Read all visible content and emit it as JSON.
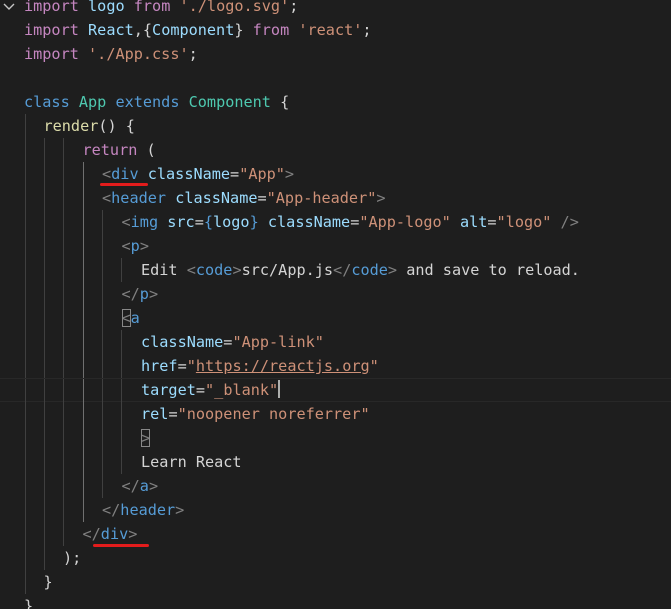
{
  "editor": {
    "language": "javascript-react",
    "lines": [
      {
        "indent": 0,
        "tokens": [
          {
            "t": "import",
            "c": "kw"
          },
          {
            "t": " ",
            "c": "pu"
          },
          {
            "t": "logo",
            "c": "vr"
          },
          {
            "t": " ",
            "c": "pu"
          },
          {
            "t": "from",
            "c": "kw"
          },
          {
            "t": " ",
            "c": "pu"
          },
          {
            "t": "'./logo.svg'",
            "c": "str"
          },
          {
            "t": ";",
            "c": "pu"
          }
        ]
      },
      {
        "indent": 0,
        "tokens": [
          {
            "t": "import",
            "c": "kw"
          },
          {
            "t": " ",
            "c": "pu"
          },
          {
            "t": "React",
            "c": "vr"
          },
          {
            "t": ",{",
            "c": "pu"
          },
          {
            "t": "Component",
            "c": "vr"
          },
          {
            "t": "} ",
            "c": "pu"
          },
          {
            "t": "from",
            "c": "kw"
          },
          {
            "t": " ",
            "c": "pu"
          },
          {
            "t": "'react'",
            "c": "str"
          },
          {
            "t": ";",
            "c": "pu"
          }
        ]
      },
      {
        "indent": 0,
        "tokens": [
          {
            "t": "import",
            "c": "kw"
          },
          {
            "t": " ",
            "c": "pu"
          },
          {
            "t": "'./App.css'",
            "c": "str"
          },
          {
            "t": ";",
            "c": "pu"
          }
        ]
      },
      {
        "indent": 0,
        "tokens": []
      },
      {
        "indent": 0,
        "tokens": [
          {
            "t": "class",
            "c": "st"
          },
          {
            "t": " ",
            "c": "pu"
          },
          {
            "t": "App",
            "c": "ty"
          },
          {
            "t": " ",
            "c": "pu"
          },
          {
            "t": "extends",
            "c": "st"
          },
          {
            "t": " ",
            "c": "pu"
          },
          {
            "t": "Component",
            "c": "ty"
          },
          {
            "t": " {",
            "c": "pu"
          }
        ]
      },
      {
        "indent": 1,
        "tokens": [
          {
            "t": "render",
            "c": "fn"
          },
          {
            "t": "() {",
            "c": "pu"
          }
        ]
      },
      {
        "indent": 3,
        "tokens": [
          {
            "t": "return",
            "c": "kw"
          },
          {
            "t": " (",
            "c": "pu"
          }
        ]
      },
      {
        "indent": 4,
        "tokens": [
          {
            "t": "<",
            "c": "br"
          },
          {
            "t": "div",
            "c": "tag"
          },
          {
            "t": " ",
            "c": "pu"
          },
          {
            "t": "className",
            "c": "vr"
          },
          {
            "t": "=",
            "c": "pu"
          },
          {
            "t": "\"App\"",
            "c": "str"
          },
          {
            "t": ">",
            "c": "br"
          }
        ]
      },
      {
        "indent": 4,
        "tokens": [
          {
            "t": "<",
            "c": "br"
          },
          {
            "t": "header",
            "c": "tag"
          },
          {
            "t": " ",
            "c": "pu"
          },
          {
            "t": "className",
            "c": "vr"
          },
          {
            "t": "=",
            "c": "pu"
          },
          {
            "t": "\"App-header\"",
            "c": "str"
          },
          {
            "t": ">",
            "c": "br"
          }
        ]
      },
      {
        "indent": 5,
        "tokens": [
          {
            "t": "<",
            "c": "br"
          },
          {
            "t": "img",
            "c": "tag"
          },
          {
            "t": " ",
            "c": "pu"
          },
          {
            "t": "src",
            "c": "vr"
          },
          {
            "t": "=",
            "c": "pu"
          },
          {
            "t": "{",
            "c": "jx"
          },
          {
            "t": "logo",
            "c": "vr"
          },
          {
            "t": "}",
            "c": "jx"
          },
          {
            "t": " ",
            "c": "pu"
          },
          {
            "t": "className",
            "c": "vr"
          },
          {
            "t": "=",
            "c": "pu"
          },
          {
            "t": "\"App-logo\"",
            "c": "str"
          },
          {
            "t": " ",
            "c": "pu"
          },
          {
            "t": "alt",
            "c": "vr"
          },
          {
            "t": "=",
            "c": "pu"
          },
          {
            "t": "\"logo\"",
            "c": "str"
          },
          {
            "t": " />",
            "c": "br"
          }
        ]
      },
      {
        "indent": 5,
        "tokens": [
          {
            "t": "<",
            "c": "br"
          },
          {
            "t": "p",
            "c": "tag"
          },
          {
            "t": ">",
            "c": "br"
          }
        ]
      },
      {
        "indent": 6,
        "tokens": [
          {
            "t": "Edit ",
            "c": "txt"
          },
          {
            "t": "<",
            "c": "br"
          },
          {
            "t": "code",
            "c": "tag"
          },
          {
            "t": ">",
            "c": "br"
          },
          {
            "t": "src/App.js",
            "c": "txt"
          },
          {
            "t": "</",
            "c": "br"
          },
          {
            "t": "code",
            "c": "tag"
          },
          {
            "t": ">",
            "c": "br"
          },
          {
            "t": " and save to reload.",
            "c": "txt"
          }
        ]
      },
      {
        "indent": 5,
        "tokens": [
          {
            "t": "</",
            "c": "br"
          },
          {
            "t": "p",
            "c": "tag"
          },
          {
            "t": ">",
            "c": "br"
          }
        ]
      },
      {
        "indent": 5,
        "tokens": [
          {
            "t": "<",
            "c": "br",
            "box": true
          },
          {
            "t": "a",
            "c": "tag"
          }
        ]
      },
      {
        "indent": 6,
        "tokens": [
          {
            "t": "className",
            "c": "vr"
          },
          {
            "t": "=",
            "c": "pu"
          },
          {
            "t": "\"App-link\"",
            "c": "str"
          }
        ]
      },
      {
        "indent": 6,
        "tokens": [
          {
            "t": "href",
            "c": "vr"
          },
          {
            "t": "=",
            "c": "pu"
          },
          {
            "t": "\"",
            "c": "str"
          },
          {
            "t": "https://reactjs.org",
            "c": "str",
            "link": true
          },
          {
            "t": "\"",
            "c": "str"
          }
        ]
      },
      {
        "indent": 6,
        "tokens": [
          {
            "t": "target",
            "c": "vr"
          },
          {
            "t": "=",
            "c": "pu"
          },
          {
            "t": "\"_blank\"",
            "c": "str"
          }
        ]
      },
      {
        "indent": 6,
        "tokens": [
          {
            "t": "rel",
            "c": "vr"
          },
          {
            "t": "=",
            "c": "pu"
          },
          {
            "t": "\"noopener noreferrer\"",
            "c": "str"
          }
        ]
      },
      {
        "indent": 6,
        "tokens": [
          {
            "t": ">",
            "c": "br",
            "box": true
          }
        ]
      },
      {
        "indent": 6,
        "tokens": [
          {
            "t": "Learn React",
            "c": "txt"
          }
        ]
      },
      {
        "indent": 5,
        "tokens": [
          {
            "t": "</",
            "c": "br"
          },
          {
            "t": "a",
            "c": "tag"
          },
          {
            "t": ">",
            "c": "br"
          }
        ]
      },
      {
        "indent": 4,
        "tokens": [
          {
            "t": "</",
            "c": "br"
          },
          {
            "t": "header",
            "c": "tag"
          },
          {
            "t": ">",
            "c": "br"
          }
        ]
      },
      {
        "indent": 3,
        "tokens": [
          {
            "t": "</",
            "c": "br"
          },
          {
            "t": "div",
            "c": "tag"
          },
          {
            "t": ">",
            "c": "br"
          }
        ]
      },
      {
        "indent": 2,
        "tokens": [
          {
            "t": ");",
            "c": "pu"
          }
        ]
      },
      {
        "indent": 1,
        "tokens": [
          {
            "t": "}",
            "c": "pu"
          }
        ]
      },
      {
        "indent": 0,
        "tokens": [
          {
            "t": "}",
            "c": "pu"
          }
        ]
      }
    ]
  },
  "icons": {
    "fold": "chevron-down-icon"
  },
  "colors": {
    "background": "#1e1e1e",
    "keyword": "#c586c0",
    "storage": "#569cd6",
    "type": "#4ec9b0",
    "function": "#dcdcaa",
    "variable": "#9cdcfe",
    "string": "#ce9178",
    "annotation": "#e31c1c"
  }
}
